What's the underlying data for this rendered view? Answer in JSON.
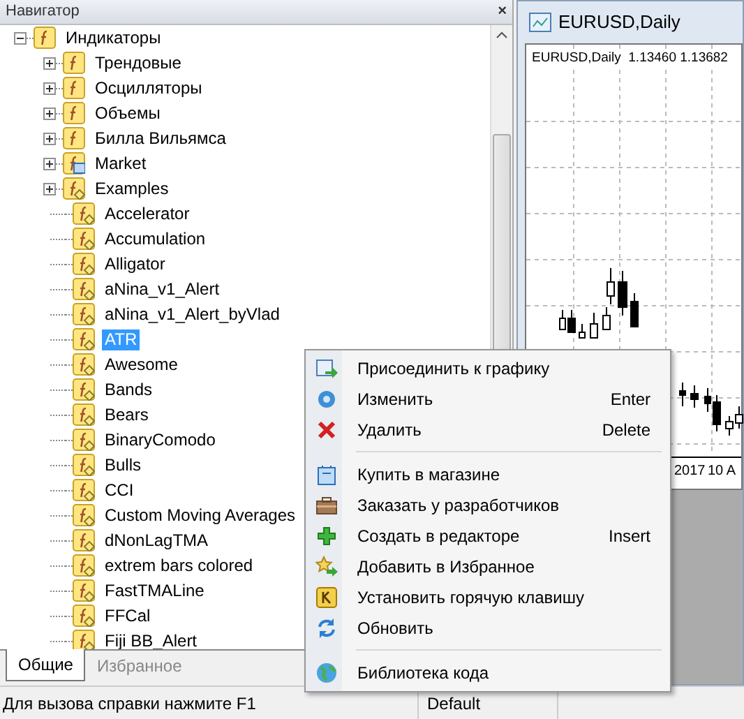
{
  "navigator": {
    "title": "Навигатор",
    "close": "×",
    "tree": [
      {
        "label": "Индикаторы",
        "kind": "folder",
        "expanded": true,
        "selected": false,
        "children": [
          {
            "label": "Трендовые",
            "kind": "folder",
            "expanded": false,
            "selected": false
          },
          {
            "label": "Осцилляторы",
            "kind": "folder",
            "expanded": false,
            "selected": false
          },
          {
            "label": "Объемы",
            "kind": "folder",
            "expanded": false,
            "selected": false
          },
          {
            "label": "Билла Вильямса",
            "kind": "folder",
            "expanded": false,
            "selected": false
          },
          {
            "label": "Market",
            "kind": "market",
            "expanded": false,
            "selected": false
          },
          {
            "label": "Examples",
            "kind": "group",
            "expanded": false,
            "selected": false
          },
          {
            "label": "Accelerator",
            "kind": "indicator",
            "selected": false
          },
          {
            "label": "Accumulation",
            "kind": "indicator",
            "selected": false
          },
          {
            "label": "Alligator",
            "kind": "indicator",
            "selected": false
          },
          {
            "label": "aNina_v1_Alert",
            "kind": "indicator",
            "selected": false
          },
          {
            "label": "aNina_v1_Alert_byVlad",
            "kind": "indicator",
            "selected": false
          },
          {
            "label": "ATR",
            "kind": "indicator",
            "selected": true
          },
          {
            "label": "Awesome",
            "kind": "indicator",
            "selected": false
          },
          {
            "label": "Bands",
            "kind": "indicator",
            "selected": false
          },
          {
            "label": "Bears",
            "kind": "indicator",
            "selected": false
          },
          {
            "label": "BinaryComodo",
            "kind": "indicator",
            "selected": false
          },
          {
            "label": "Bulls",
            "kind": "indicator",
            "selected": false
          },
          {
            "label": "CCI",
            "kind": "indicator",
            "selected": false
          },
          {
            "label": "Custom Moving Averages",
            "kind": "indicator",
            "selected": false
          },
          {
            "label": "dNonLagTMA",
            "kind": "indicator",
            "selected": false
          },
          {
            "label": "extrem bars colored",
            "kind": "indicator",
            "selected": false
          },
          {
            "label": "FastTMALine",
            "kind": "indicator",
            "selected": false
          },
          {
            "label": "FFCal",
            "kind": "indicator",
            "selected": false
          },
          {
            "label": "Fiji BB_Alert",
            "kind": "indicator",
            "selected": false
          }
        ]
      }
    ],
    "tabs": [
      {
        "label": "Общие",
        "selected": true
      },
      {
        "label": "Избранное",
        "selected": false
      }
    ]
  },
  "chart_window": {
    "title": "EURUSD,Daily",
    "header": "EURUSD,Daily  1.13460 1.13682",
    "x_labels": [
      "2017",
      "10 A"
    ]
  },
  "context_menu": [
    {
      "kind": "item",
      "label": "Присоединить к графику"
    },
    {
      "kind": "item",
      "label": "Изменить",
      "shortcut": "Enter"
    },
    {
      "kind": "item",
      "label": "Удалить",
      "shortcut": "Delete"
    },
    {
      "kind": "separator"
    },
    {
      "kind": "item",
      "label": "Купить в магазине"
    },
    {
      "kind": "item",
      "label": "Заказать у разработчиков"
    },
    {
      "kind": "item",
      "label": "Создать в редакторе",
      "shortcut": "Insert"
    },
    {
      "kind": "item",
      "label": "Добавить в Избранное"
    },
    {
      "kind": "item",
      "label": "Установить горячую клавишу"
    },
    {
      "kind": "item",
      "label": "Обновить"
    },
    {
      "kind": "separator"
    },
    {
      "kind": "item",
      "label": "Библиотека кода"
    }
  ],
  "status_bar": {
    "help": "Для вызова справки нажмите F1",
    "profile": "Default"
  }
}
